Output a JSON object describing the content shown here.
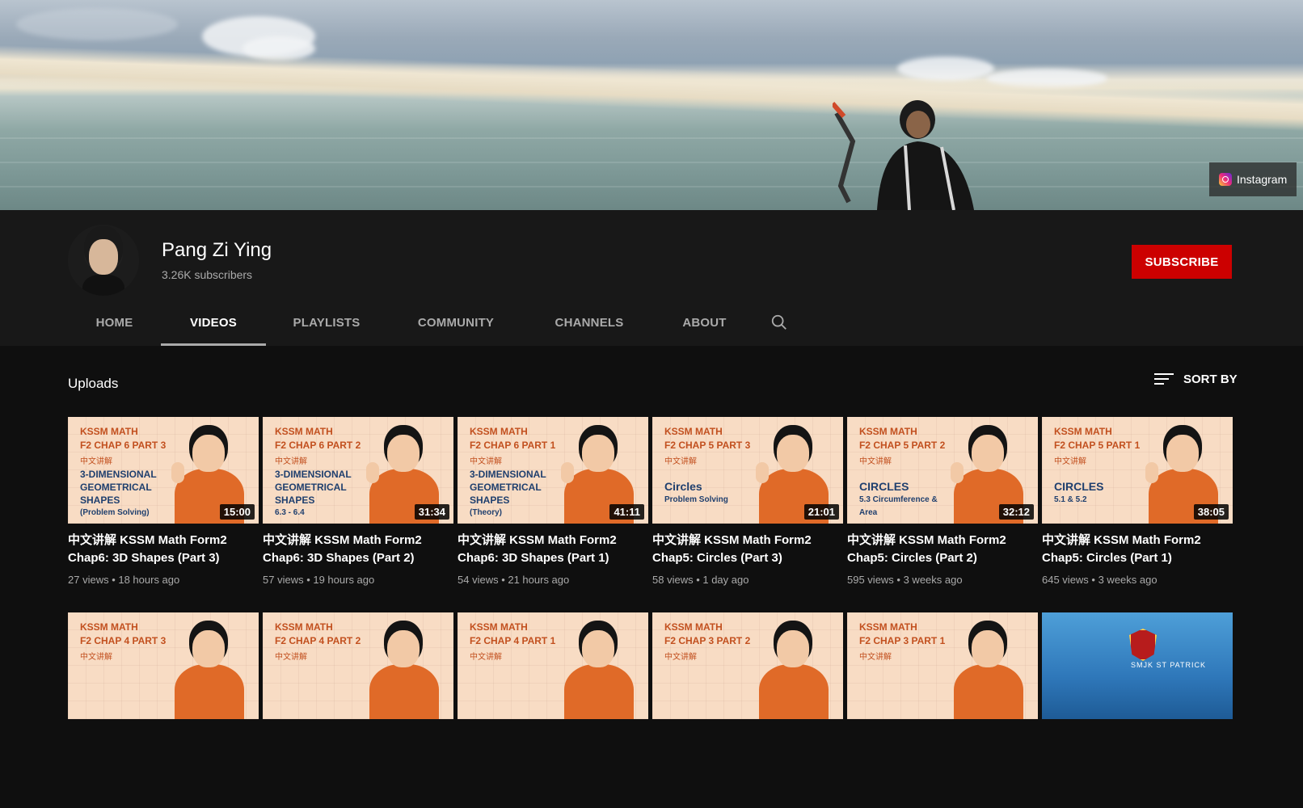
{
  "banner": {
    "link_label": "Instagram",
    "colors": {
      "sky": "#9aa9b8",
      "sand": "#efe6d2",
      "water": "#8fa8a5"
    }
  },
  "channel": {
    "name": "Pang Zi Ying",
    "subscribers": "3.26K subscribers",
    "subscribe_label": "SUBSCRIBE",
    "subscribe_color": "#cc0000"
  },
  "tabs": [
    {
      "label": "HOME",
      "active": false
    },
    {
      "label": "VIDEOS",
      "active": true
    },
    {
      "label": "PLAYLISTS",
      "active": false
    },
    {
      "label": "COMMUNITY",
      "active": false
    },
    {
      "label": "CHANNELS",
      "active": false
    },
    {
      "label": "ABOUT",
      "active": false
    }
  ],
  "uploads": {
    "title": "Uploads",
    "sort_label": "SORT BY"
  },
  "videos": [
    {
      "thumb_line1": "KSSM MATH",
      "thumb_line2": "F2 CHAP 6 PART 3",
      "thumb_line3": "中文讲解",
      "thumb_topic": "3-DIMENSIONAL GEOMETRICAL SHAPES",
      "thumb_sub": "(Problem Solving)",
      "duration": "15:00",
      "title": "中文讲解 KSSM Math Form2 Chap6: 3D Shapes (Part 3)",
      "views": "27 views",
      "age": "18 hours ago"
    },
    {
      "thumb_line1": "KSSM MATH",
      "thumb_line2": "F2 CHAP 6 PART 2",
      "thumb_line3": "中文讲解",
      "thumb_topic": "3-DIMENSIONAL GEOMETRICAL SHAPES",
      "thumb_sub": "6.3 - 6.4",
      "duration": "31:34",
      "title": "中文讲解 KSSM Math Form2 Chap6: 3D Shapes (Part 2)",
      "views": "57 views",
      "age": "19 hours ago"
    },
    {
      "thumb_line1": "KSSM MATH",
      "thumb_line2": "F2 CHAP 6 PART 1",
      "thumb_line3": "中文讲解",
      "thumb_topic": "3-DIMENSIONAL GEOMETRICAL SHAPES",
      "thumb_sub": "(Theory)",
      "duration": "41:11",
      "title": "中文讲解 KSSM Math Form2 Chap6: 3D Shapes (Part 1)",
      "views": "54 views",
      "age": "21 hours ago"
    },
    {
      "thumb_line1": "KSSM MATH",
      "thumb_line2": "F2 CHAP 5 PART 3",
      "thumb_line3": "中文讲解",
      "thumb_topic": "Circles",
      "thumb_sub": "Problem Solving",
      "duration": "21:01",
      "title": "中文讲解 KSSM Math Form2 Chap5: Circles (Part 3)",
      "views": "58 views",
      "age": "1 day ago"
    },
    {
      "thumb_line1": "KSSM MATH",
      "thumb_line2": "F2 CHAP 5 PART 2",
      "thumb_line3": "中文讲解",
      "thumb_topic": "CIRCLES",
      "thumb_sub": "5.3 Circumference & Area",
      "duration": "32:12",
      "title": "中文讲解 KSSM Math Form2 Chap5: Circles (Part 2)",
      "views": "595 views",
      "age": "3 weeks ago"
    },
    {
      "thumb_line1": "KSSM MATH",
      "thumb_line2": "F2 CHAP 5 PART 1",
      "thumb_line3": "中文讲解",
      "thumb_topic": "CIRCLES",
      "thumb_sub": "5.1 & 5.2",
      "duration": "38:05",
      "title": "中文讲解 KSSM Math Form2 Chap5: Circles (Part 1)",
      "views": "645 views",
      "age": "3 weeks ago"
    }
  ],
  "videos_row2": [
    {
      "thumb_line1": "KSSM MATH",
      "thumb_line2": "F2 CHAP 4 PART 3",
      "thumb_line3": "中文讲解"
    },
    {
      "thumb_line1": "KSSM MATH",
      "thumb_line2": "F2 CHAP 4 PART 2",
      "thumb_line3": "中文讲解"
    },
    {
      "thumb_line1": "KSSM MATH",
      "thumb_line2": "F2 CHAP 4 PART 1",
      "thumb_line3": "中文讲解"
    },
    {
      "thumb_line1": "KSSM MATH",
      "thumb_line2": "F2 CHAP 3 PART 2",
      "thumb_line3": "中文讲解"
    },
    {
      "thumb_line1": "KSSM MATH",
      "thumb_line2": "F2 CHAP 3 PART 1",
      "thumb_line3": "中文讲解"
    },
    {
      "thumb_caption": "SMJK ST PATRICK"
    }
  ],
  "icons": {
    "search": "search-icon",
    "sort": "sort-icon",
    "instagram": "instagram-icon"
  }
}
